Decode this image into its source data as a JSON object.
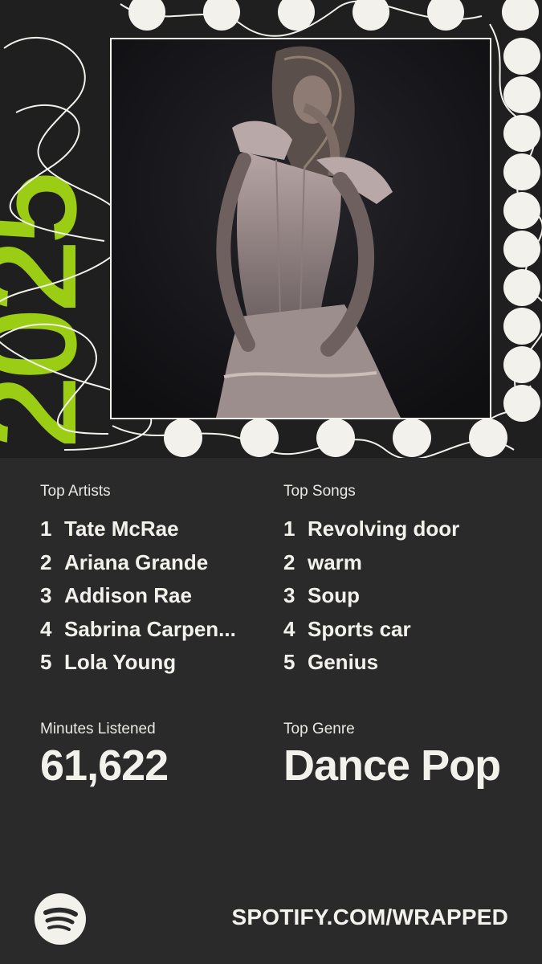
{
  "year_graphic": "2025",
  "top_artists": {
    "label": "Top Artists",
    "items": [
      {
        "rank": "1",
        "name": "Tate McRae"
      },
      {
        "rank": "2",
        "name": "Ariana Grande"
      },
      {
        "rank": "3",
        "name": "Addison Rae"
      },
      {
        "rank": "4",
        "name": "Sabrina Carpen..."
      },
      {
        "rank": "5",
        "name": "Lola Young"
      }
    ]
  },
  "top_songs": {
    "label": "Top Songs",
    "items": [
      {
        "rank": "1",
        "name": "Revolving door"
      },
      {
        "rank": "2",
        "name": "warm"
      },
      {
        "rank": "3",
        "name": "Soup"
      },
      {
        "rank": "4",
        "name": "Sports car"
      },
      {
        "rank": "5",
        "name": "Genius"
      }
    ]
  },
  "minutes": {
    "label": "Minutes Listened",
    "value": "61,622"
  },
  "genre": {
    "label": "Top Genre",
    "value": "Dance Pop"
  },
  "footer": {
    "url": "SPOTIFY.COM/WRAPPED",
    "logo_icon": "spotify-logo-icon"
  },
  "colors": {
    "accent_green": "#9acd14",
    "background": "#2a2a2a",
    "text": "#f2f1ec"
  }
}
